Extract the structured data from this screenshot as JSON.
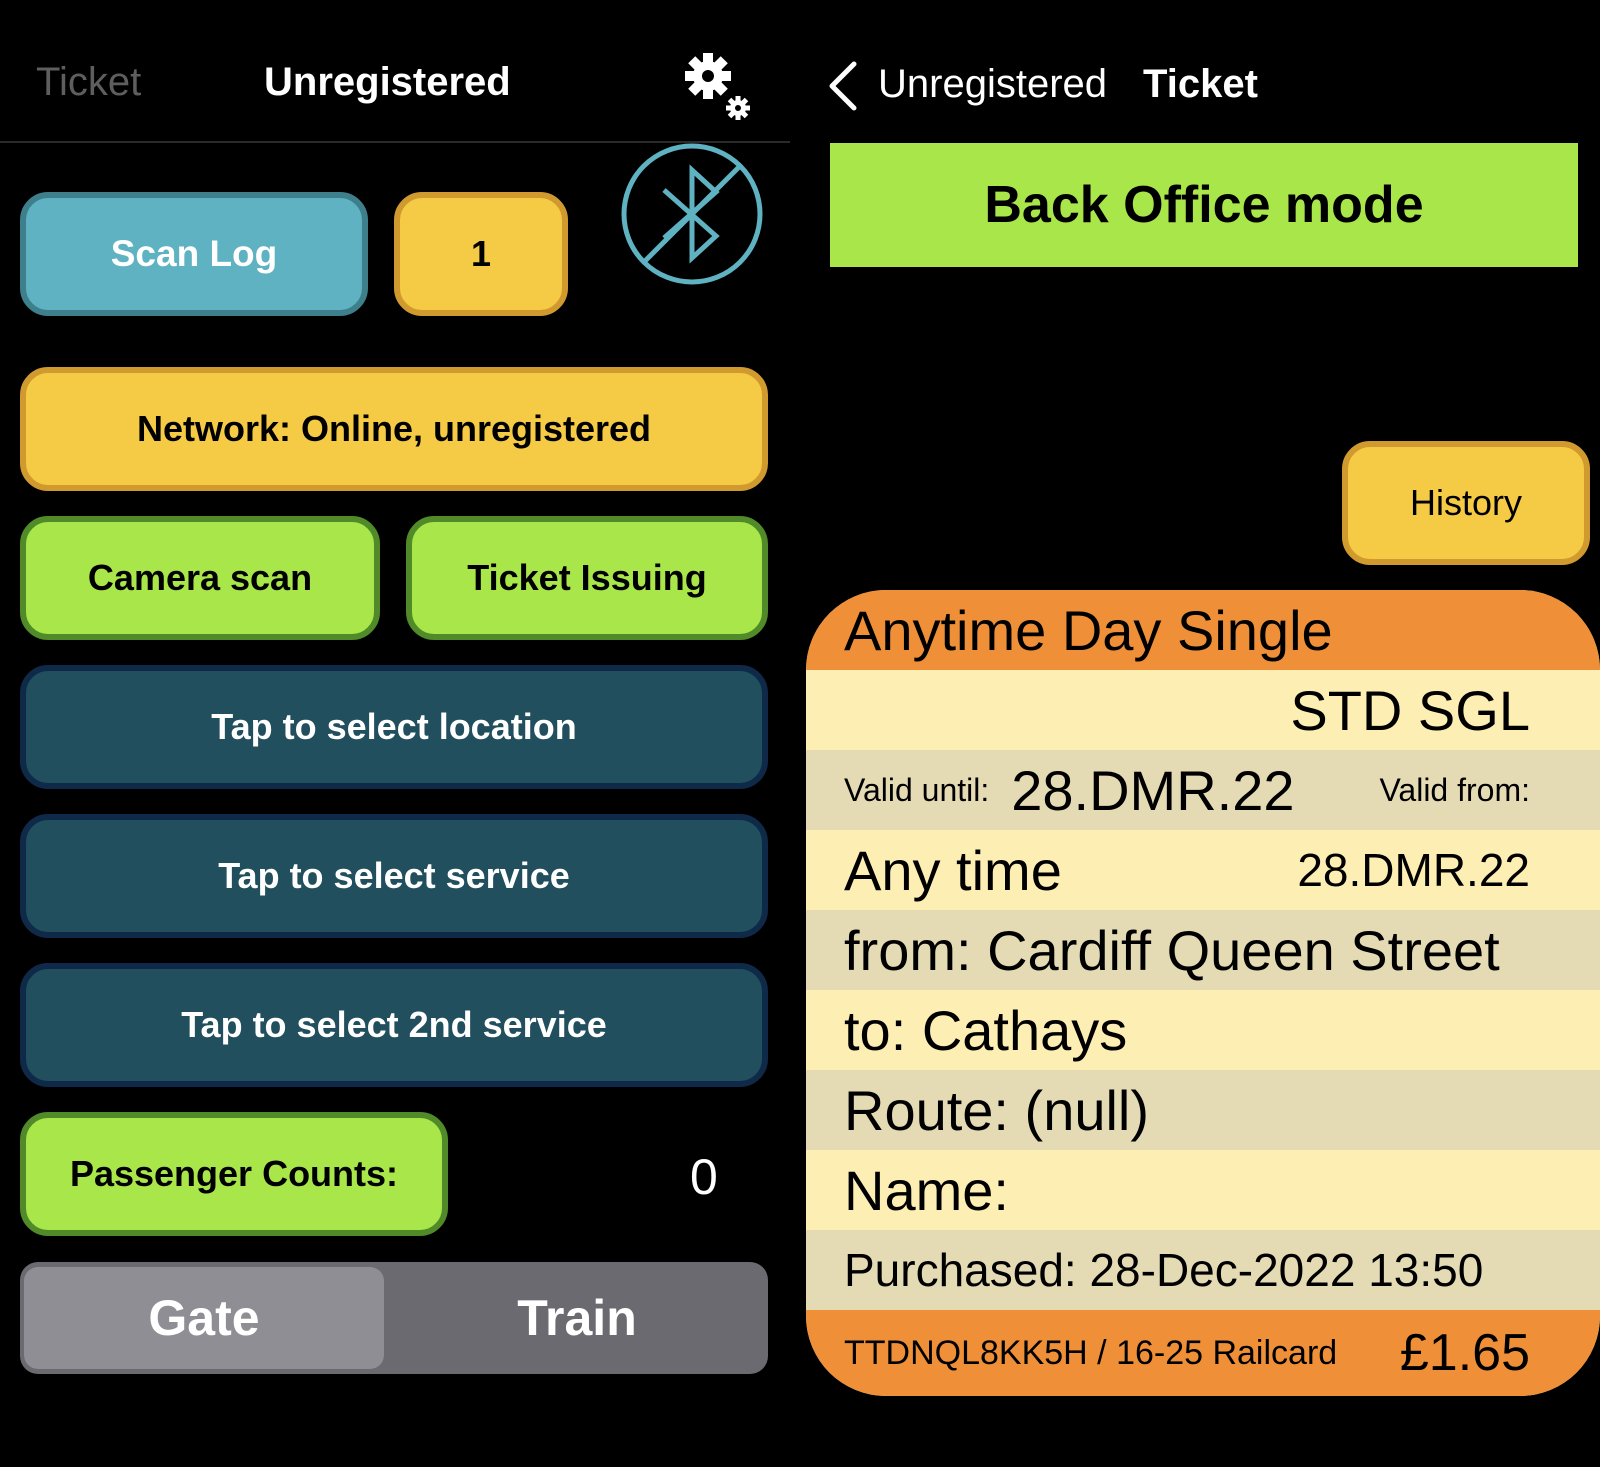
{
  "left_screen": {
    "nav": {
      "back_label": "Ticket",
      "title": "Unregistered",
      "settings_icon": "gear-icon"
    },
    "bluetooth_icon": "bluetooth-disabled-icon",
    "scan_log_label": "Scan Log",
    "scan_count": "1",
    "network_status": "Network: Online, unregistered",
    "camera_scan_label": "Camera scan",
    "ticket_issuing_label": "Ticket Issuing",
    "select_location_label": "Tap to select location",
    "select_service_label": "Tap to select service",
    "select_2nd_service_label": "Tap to select 2nd service",
    "passenger_counts_label": "Passenger Counts:",
    "passenger_counts_value": "0",
    "mode_segments": [
      {
        "label": "Gate",
        "selected": true
      },
      {
        "label": "Train",
        "selected": false
      }
    ]
  },
  "right_screen": {
    "nav": {
      "back_icon": "chevron-left-icon",
      "back_label": "Unregistered",
      "title": "Ticket"
    },
    "mode_banner": "Back Office mode",
    "history_label": "History",
    "ticket": {
      "type": "Anytime Day Single",
      "class_code": "STD SGL",
      "valid_until_label": "Valid until:",
      "valid_until": "28.DMR.22",
      "valid_from_label": "Valid from:",
      "time_restriction": "Any time",
      "valid_from": "28.DMR.22",
      "from": "from: Cardiff Queen Street",
      "to": "to: Cathays",
      "route": "Route: (null)",
      "name": "Name:",
      "purchased": "Purchased: 28-Dec-2022 13:50",
      "reference_railcard": "TTDNQL8KK5H / 16-25 Railcard",
      "price": "£1.65"
    }
  },
  "colors": {
    "background": "#000000",
    "teal_button": "#5fb2c2",
    "yellow_button": "#f5ca45",
    "green_button": "#a8e64a",
    "dark_button": "#214f5e",
    "ticket_orange": "#ef8f38",
    "ticket_cream": "#fdeeb4",
    "ticket_stripe": "#e4dbb5",
    "bluetooth": "#5fb2c2"
  }
}
